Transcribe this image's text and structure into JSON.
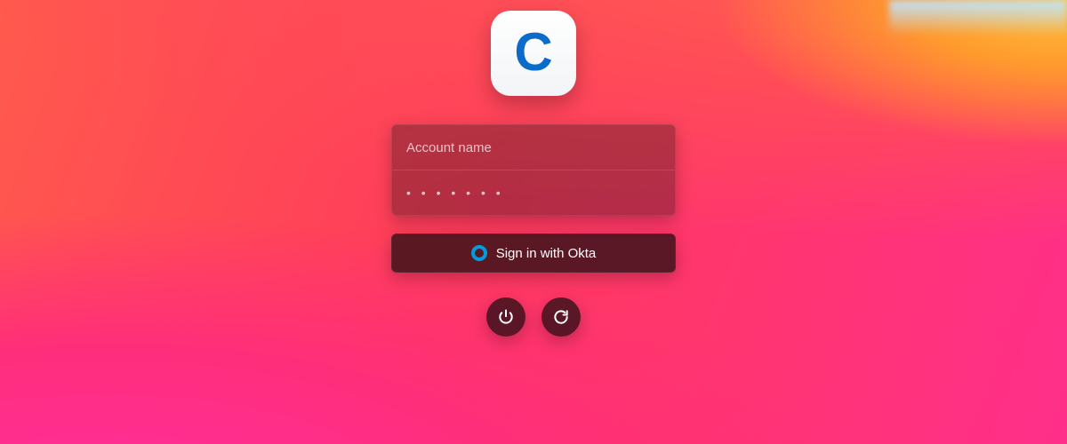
{
  "app": {
    "letter": "C"
  },
  "login": {
    "account_placeholder": "Account name",
    "password_placeholder": "• • • • • • •",
    "sso_label": "Sign in with Okta"
  }
}
